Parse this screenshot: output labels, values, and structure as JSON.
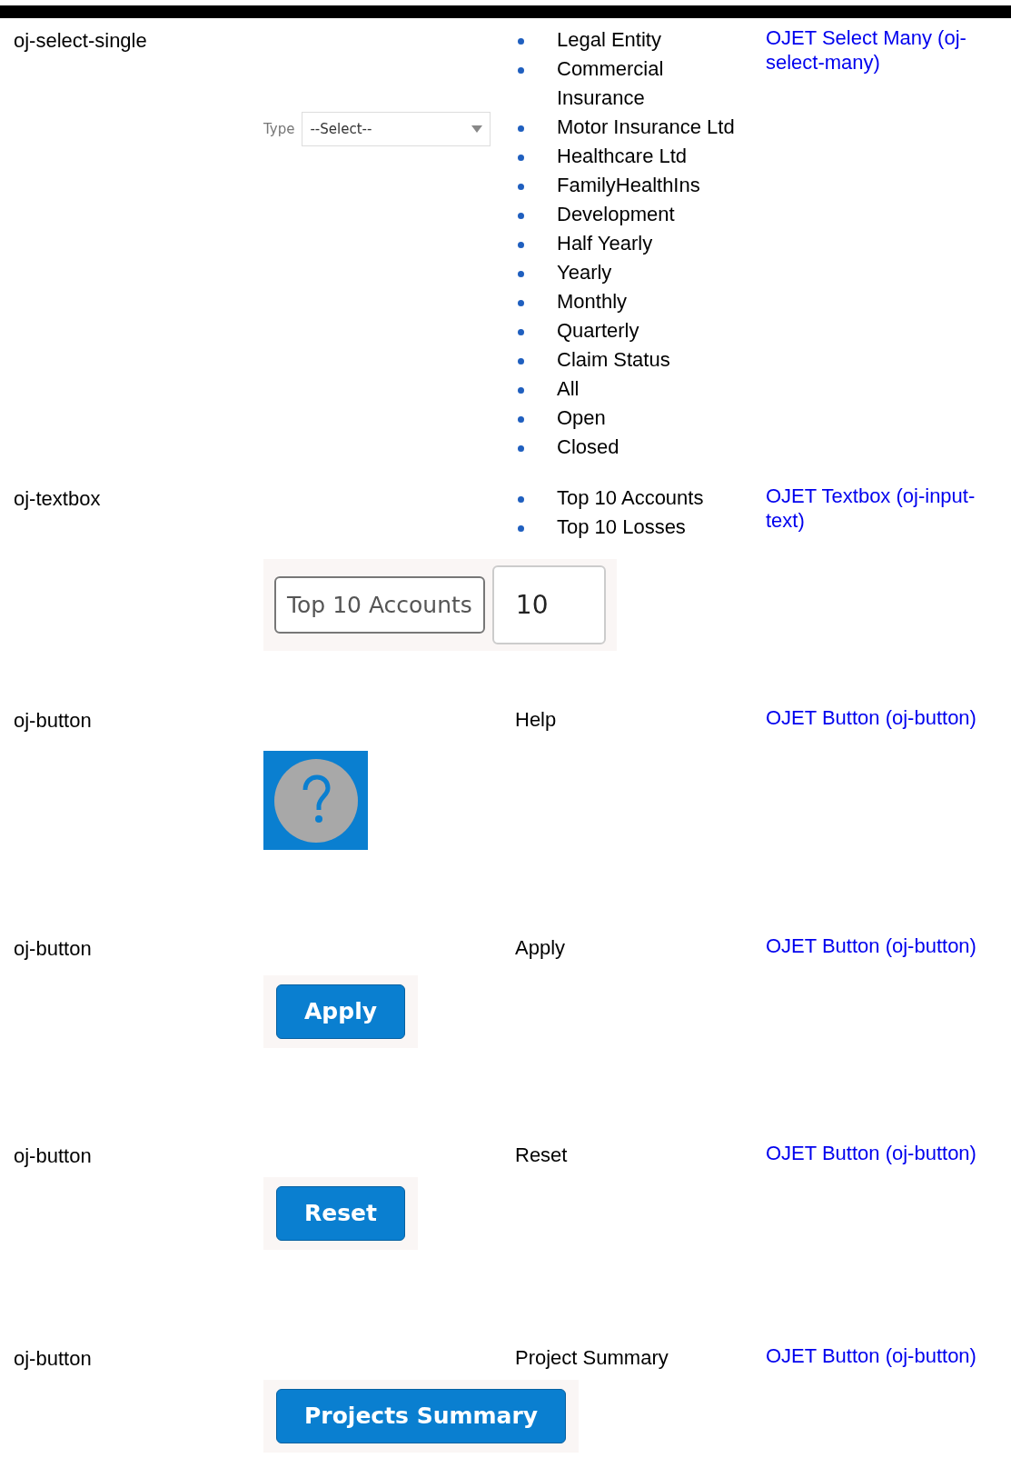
{
  "rows": [
    {
      "component": "oj-select-single",
      "labels": [
        "Legal Entity",
        "Commercial Insurance",
        "Motor Insurance Ltd",
        "Healthcare Ltd",
        "FamilyHealthIns",
        "Development",
        "Half Yearly",
        "Yearly",
        "Monthly",
        "Quarterly",
        "Claim Status",
        "All",
        "Open",
        "Closed"
      ],
      "bulleted": true,
      "link": "OJET Select Many (oj-select-many)",
      "preview": {
        "kind": "select",
        "label": "Type",
        "value": "--Select--"
      }
    },
    {
      "component": "oj-textbox",
      "labels": [
        "Top 10 Accounts",
        "Top 10 Losses"
      ],
      "bulleted": true,
      "link": "OJET Textbox (oj-input-text)",
      "preview": {
        "kind": "textbox",
        "label": "Top 10 Accounts",
        "value": "10"
      }
    },
    {
      "component": "oj-button",
      "labels": [
        "Help"
      ],
      "bulleted": false,
      "link": "OJET Button (oj-button)",
      "preview": {
        "kind": "help"
      }
    },
    {
      "component": "oj-button",
      "labels": [
        "Apply"
      ],
      "bulleted": false,
      "link": "OJET Button (oj-button)",
      "preview": {
        "kind": "button",
        "label": "Apply"
      }
    },
    {
      "component": "oj-button",
      "labels": [
        "Reset"
      ],
      "bulleted": false,
      "link": "OJET Button (oj-button)",
      "preview": {
        "kind": "button",
        "label": "Reset"
      }
    },
    {
      "component": "oj-button",
      "labels": [
        "Project Summary"
      ],
      "bulleted": false,
      "link": "OJET Button (oj-button)",
      "preview": {
        "kind": "button",
        "label": "Projects Summary"
      }
    }
  ]
}
